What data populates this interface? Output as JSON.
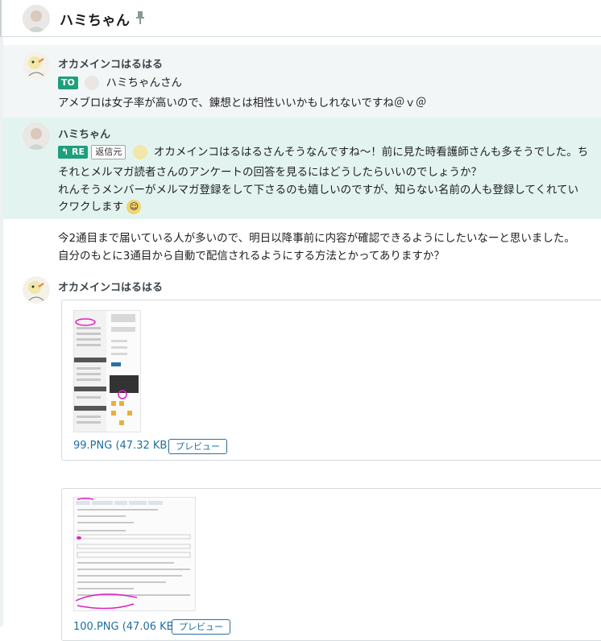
{
  "header": {
    "room_title": "ハミちゃん"
  },
  "messages": [
    {
      "sender": "オカメインコはるはる",
      "to_badge": "TO",
      "to_name": "ハミちゃんさん",
      "lines": [
        "アメブロは女子率が高いので、錬想とは相性いいかもしれないですね＠ｖ＠"
      ]
    },
    {
      "sender": "ハミちゃん",
      "re_badge": "RE",
      "re_source": "返信元",
      "lines": [
        "オカメインコはるはるさんそうなんですね〜！前に見た時看護師さんも多そうでした。ち",
        "それとメルマガ読者さんのアンケートの回答を見るにはどうしたらいいのでしょうか？",
        "れんそうメンバーがメルマガ登録をして下さるのも嬉しいのですが、知らない名前の人も登録してくれてい",
        "クワクします"
      ]
    },
    {
      "lines": [
        "今2通目まで届いている人が多いので、明日以降事前に内容が確認できるようにしたいなーと思いました。",
        "自分のもとに3通目から自動で配信されるようにする方法とかってありますか？"
      ]
    },
    {
      "sender": "オカメインコはるはる",
      "files": [
        {
          "name": "99.PNG (47.32 KB)",
          "preview": "プレビュー"
        },
        {
          "name": "100.PNG (47.06 KB)",
          "preview": "プレビュー"
        }
      ]
    }
  ],
  "colors": {
    "accent": "#1f9e7b",
    "highlight_bg": "#e3f4f0",
    "link": "#1f6ea0"
  }
}
